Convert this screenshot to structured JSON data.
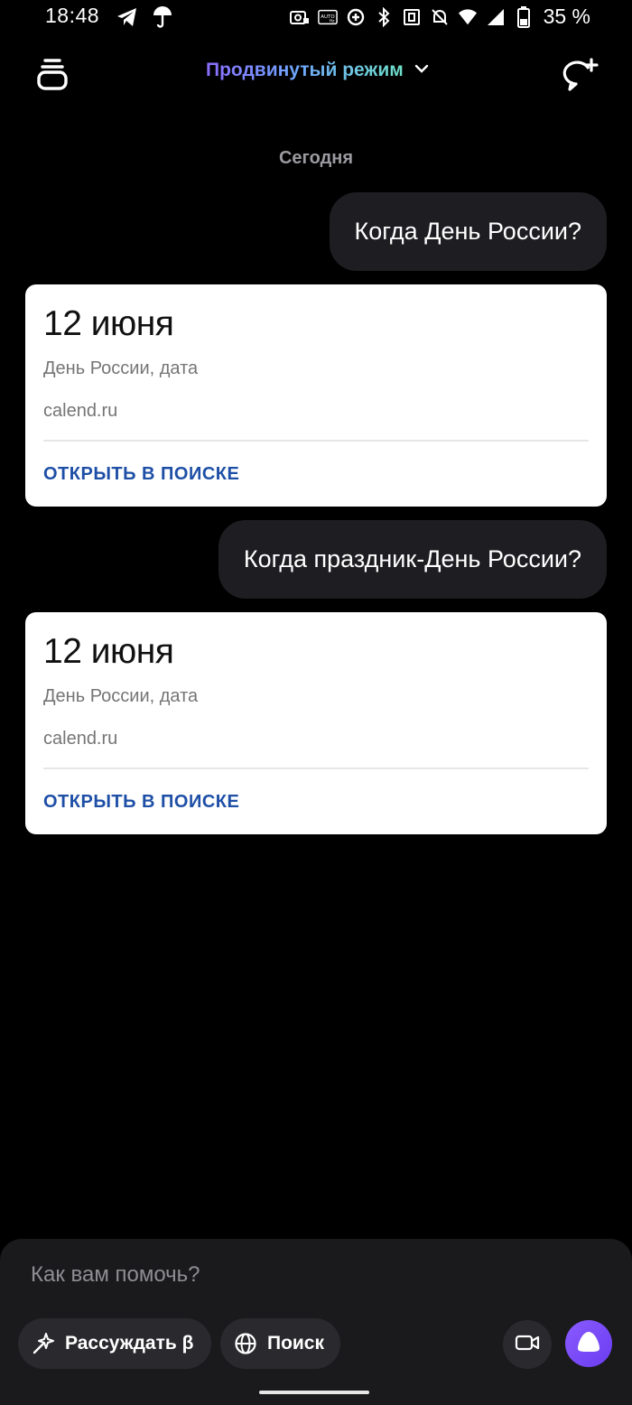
{
  "status_bar": {
    "time": "18:48",
    "battery_text": "35 %",
    "left_icons": [
      "telegram-icon",
      "umbrella-icon"
    ],
    "right_icons": [
      "screenshot-lock-icon",
      "auto-hz-icon",
      "data-saver-icon",
      "bluetooth-icon",
      "nfc-icon",
      "mute-icon",
      "wifi-icon",
      "signal-icon",
      "battery-icon"
    ]
  },
  "header": {
    "mode_label": "Продвинутый режим",
    "history_icon": "chat-history-icon",
    "new_chat_icon": "new-chat-icon"
  },
  "date_separator": "Сегодня",
  "messages": [
    {
      "user_text": "Когда День России?",
      "answer": {
        "title": "12 июня",
        "subtitle": "День России, дата",
        "source": "calend.ru",
        "link": "ОТКРЫТЬ В ПОИСКЕ"
      }
    },
    {
      "user_text": "Когда праздник-День России?",
      "answer": {
        "title": "12 июня",
        "subtitle": "День России, дата",
        "source": "calend.ru",
        "link": "ОТКРЫТЬ В ПОИСКЕ"
      }
    }
  ],
  "composer": {
    "placeholder": "Как вам помочь?",
    "reason_label": "Рассуждать β",
    "search_label": "Поиск"
  },
  "colors": {
    "background": "#000000",
    "bubble": "#1e1e22",
    "card": "#ffffff",
    "link": "#1e4fa6",
    "accent_purple": "#7a4cff"
  }
}
